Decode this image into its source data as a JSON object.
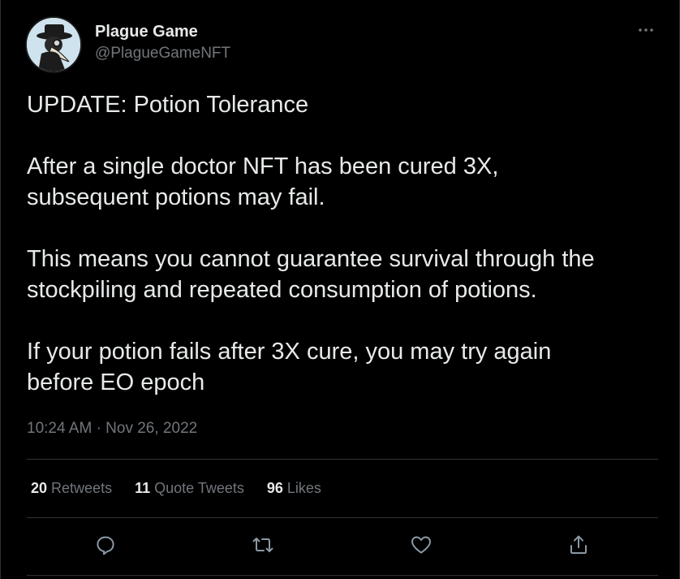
{
  "author": {
    "display_name": "Plague Game",
    "handle": "@PlagueGameNFT",
    "avatar_icon": "plague-doctor-avatar"
  },
  "tweet": {
    "paragraphs": [
      "UPDATE: Potion Tolerance",
      "After a single doctor NFT has been cured 3X,\nsubsequent potions may fail.",
      "This means you cannot guarantee survival through the\nstockpiling and repeated consumption of potions.",
      "If your potion fails after 3X cure, you may try again\nbefore EO epoch"
    ],
    "time": "10:24 AM",
    "separator": "·",
    "date": "Nov 26, 2022"
  },
  "stats": {
    "retweets_count": "20",
    "retweets_label": "Retweets",
    "quotes_count": "11",
    "quotes_label": "Quote Tweets",
    "likes_count": "96",
    "likes_label": "Likes"
  },
  "actions": {
    "reply_icon": "reply-icon",
    "retweet_icon": "retweet-icon",
    "like_icon": "like-icon",
    "share_icon": "share-icon",
    "more_icon": "more-icon"
  },
  "colors": {
    "background": "#000000",
    "text_primary": "#e7e9ea",
    "text_secondary": "#71767b",
    "divider": "#2f3336"
  }
}
